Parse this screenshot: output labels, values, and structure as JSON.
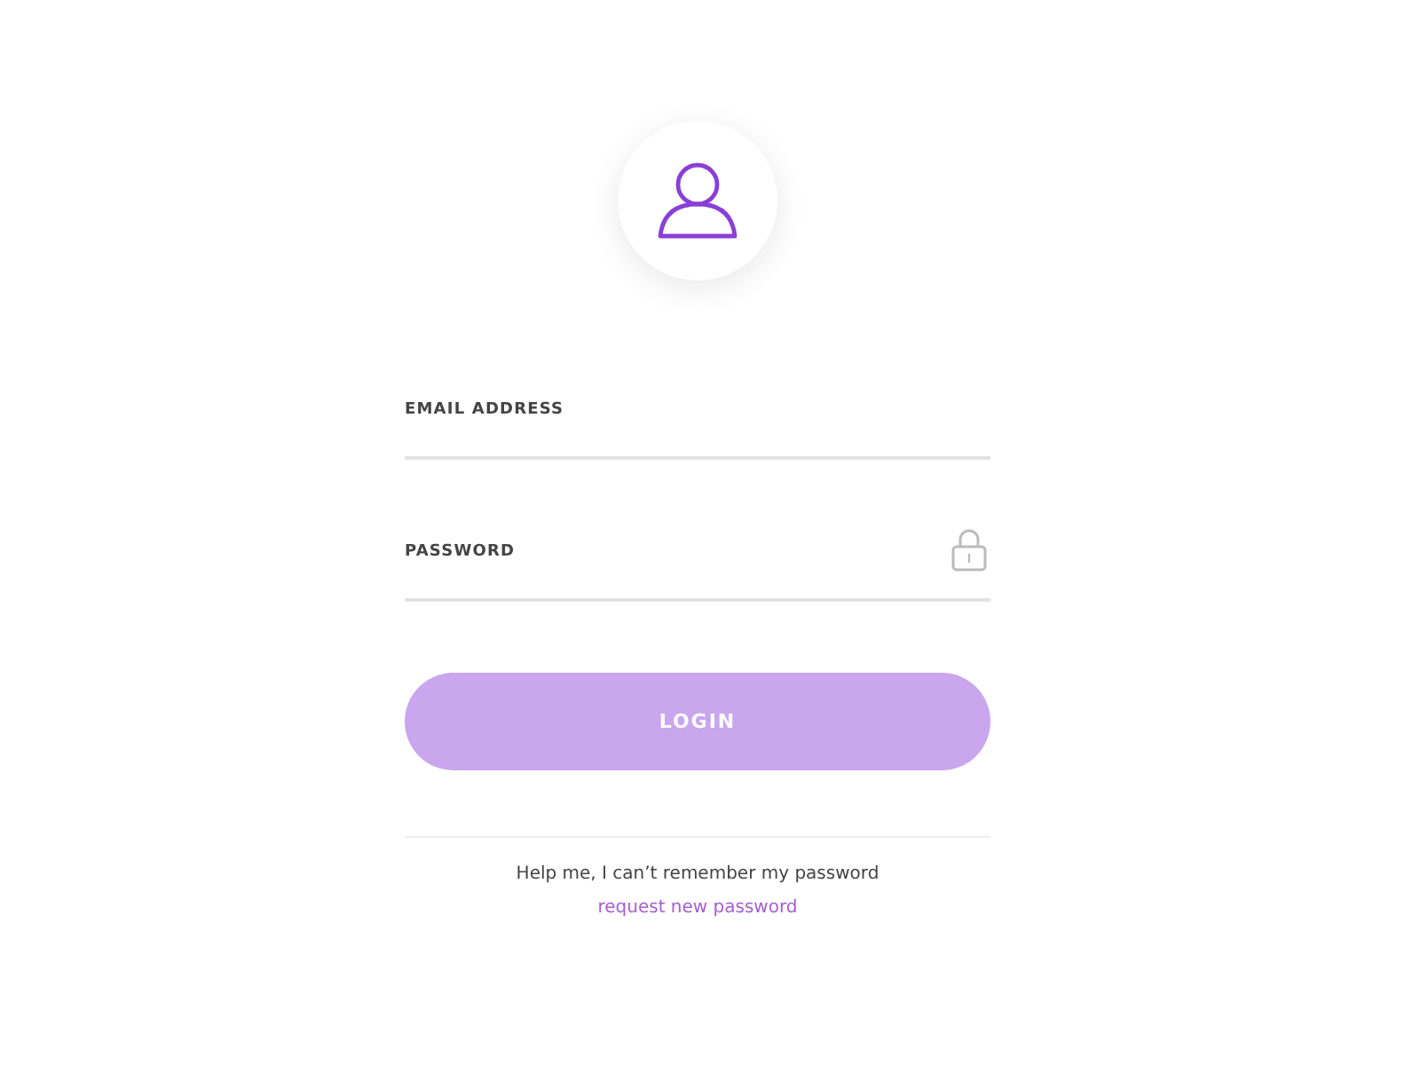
{
  "fields": [
    {
      "kind": "email",
      "label": "EMAIL ADDRESS"
    },
    {
      "kind": "password",
      "label": "PASSWORD"
    }
  ],
  "login_button": {
    "label": "LOGIN",
    "disabled": true
  },
  "help_text": "Help me, I can’t remember my password",
  "request_link": "request new password"
}
